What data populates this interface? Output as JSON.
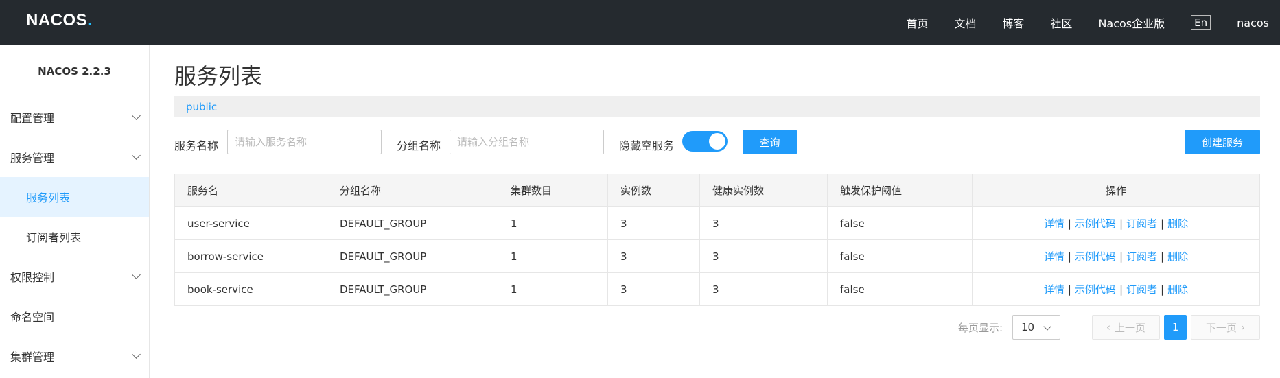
{
  "header": {
    "logo": "NACOS",
    "logo_dot": ".",
    "nav": [
      "首页",
      "文档",
      "博客",
      "社区",
      "Nacos企业版"
    ],
    "lang": "En",
    "user": "nacos"
  },
  "sidebar": {
    "version": "NACOS 2.2.3",
    "items": [
      {
        "label": "配置管理"
      },
      {
        "label": "服务管理"
      },
      {
        "label": "服务列表"
      },
      {
        "label": "订阅者列表"
      },
      {
        "label": "权限控制"
      },
      {
        "label": "命名空间"
      },
      {
        "label": "集群管理"
      }
    ]
  },
  "main": {
    "title": "服务列表",
    "namespace": "public",
    "filters": {
      "service_label": "服务名称",
      "service_placeholder": "请输入服务名称",
      "group_label": "分组名称",
      "group_placeholder": "请输入分组名称",
      "hide_empty_label": "隐藏空服务",
      "hide_empty_on": true,
      "query_button": "查询",
      "create_button": "创建服务"
    },
    "table": {
      "headers": [
        "服务名",
        "分组名称",
        "集群数目",
        "实例数",
        "健康实例数",
        "触发保护阈值",
        "操作"
      ],
      "rows": [
        [
          "user-service",
          "DEFAULT_GROUP",
          "1",
          "3",
          "3",
          "false"
        ],
        [
          "borrow-service",
          "DEFAULT_GROUP",
          "1",
          "3",
          "3",
          "false"
        ],
        [
          "book-service",
          "DEFAULT_GROUP",
          "1",
          "3",
          "3",
          "false"
        ]
      ],
      "ops": [
        "详情",
        "示例代码",
        "订阅者",
        "删除"
      ],
      "op_separator": "|"
    },
    "pagination": {
      "per_page_label": "每页显示:",
      "per_page_value": "10",
      "prev": "上一页",
      "next": "下一页",
      "current_page": "1"
    }
  },
  "colors": {
    "header_bg": "#252a2f",
    "accent": "#209bfa",
    "logo_accent": "#24c0ff",
    "active_bg": "#e5f3ff"
  }
}
